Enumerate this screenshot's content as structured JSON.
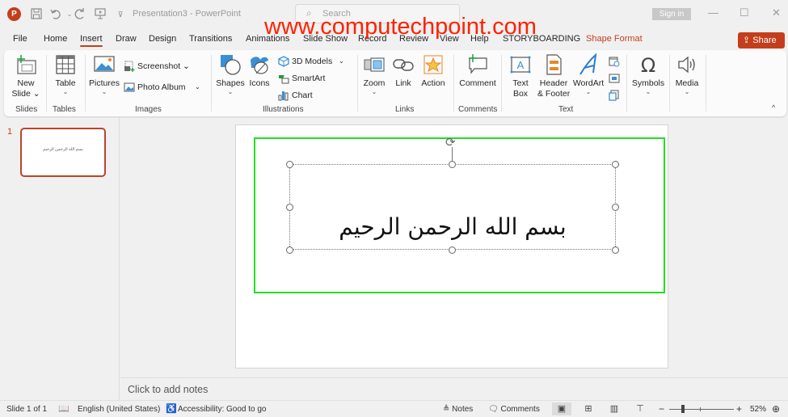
{
  "titlebar": {
    "app_icon": "P",
    "save_icon": "save-icon",
    "undo_icon": "undo-icon",
    "redo_icon": "redo-icon",
    "present_icon": "present-icon",
    "customize_icon": "customize-qat-icon",
    "document_title": "Presentation3  -  PowerPoint",
    "search_placeholder": "Search",
    "sign_in": "Sign in",
    "minimize": "—",
    "maximize": "☐",
    "close": "✕"
  },
  "watermark": "www.computechpoint.com",
  "tabs": [
    {
      "label": "File",
      "active": false
    },
    {
      "label": "Home",
      "active": false
    },
    {
      "label": "Insert",
      "active": true
    },
    {
      "label": "Draw",
      "active": false
    },
    {
      "label": "Design",
      "active": false
    },
    {
      "label": "Transitions",
      "active": false
    },
    {
      "label": "Animations",
      "active": false
    },
    {
      "label": "Slide Show",
      "active": false
    },
    {
      "label": "Record",
      "active": false
    },
    {
      "label": "Review",
      "active": false
    },
    {
      "label": "View",
      "active": false
    },
    {
      "label": "Help",
      "active": false
    },
    {
      "label": "STORYBOARDING",
      "active": false
    },
    {
      "label": "Shape Format",
      "active": false,
      "contextual": true
    }
  ],
  "share": {
    "label": "Share",
    "chevron": "⌄"
  },
  "ribbon": {
    "groups": {
      "slides": "Slides",
      "tables": "Tables",
      "images": "Images",
      "illustrations": "Illustrations",
      "links": "Links",
      "comments": "Comments",
      "text": "Text"
    },
    "new_slide": {
      "line1": "New",
      "line2": "Slide ⌄"
    },
    "table": {
      "label": "Table",
      "dd": "⌄"
    },
    "pictures": {
      "label": "Pictures",
      "dd": "⌄"
    },
    "screenshot": "Screenshot ⌄",
    "photo_album": "Photo Album",
    "images_more": "⌄",
    "shapes": {
      "label": "Shapes",
      "dd": "⌄"
    },
    "icons": "Icons",
    "models_3d": "3D Models",
    "models_more": "⌄",
    "smartart": "SmartArt",
    "chart": "Chart",
    "zoom": {
      "label": "Zoom",
      "dd": "⌄"
    },
    "link": "Link",
    "action": "Action",
    "comment": "Comment",
    "text_box": {
      "line1": "Text",
      "line2": "Box"
    },
    "header_footer": {
      "line1": "Header",
      "line2": "& Footer"
    },
    "wordart": {
      "label": "WordArt",
      "dd": "⌄"
    },
    "symbols": {
      "label": "Symbols",
      "dd": "⌄"
    },
    "media": {
      "label": "Media",
      "dd": "⌄"
    },
    "collapse": "^"
  },
  "thumbnails": [
    {
      "number": "1",
      "text": "بسم الله الرحمن الرحيم"
    }
  ],
  "slide": {
    "text": "بسم الله الرحمن الرحيم",
    "rotate_icon": "⟳"
  },
  "notes": {
    "placeholder": "Click to add notes"
  },
  "status": {
    "slide_info": "Slide 1 of 1",
    "spell_icon": "book-icon",
    "language": "English (United States)",
    "accessibility": "Accessibility: Good to go",
    "notes": "Notes",
    "comments": "Comments",
    "zoom_minus": "−",
    "zoom_plus": "+",
    "zoom_level": "52%",
    "fit_icon": "⊕"
  },
  "colors": {
    "accent": "#c43e1c",
    "selection_green": "#22e022",
    "watermark": "#ff2200"
  }
}
